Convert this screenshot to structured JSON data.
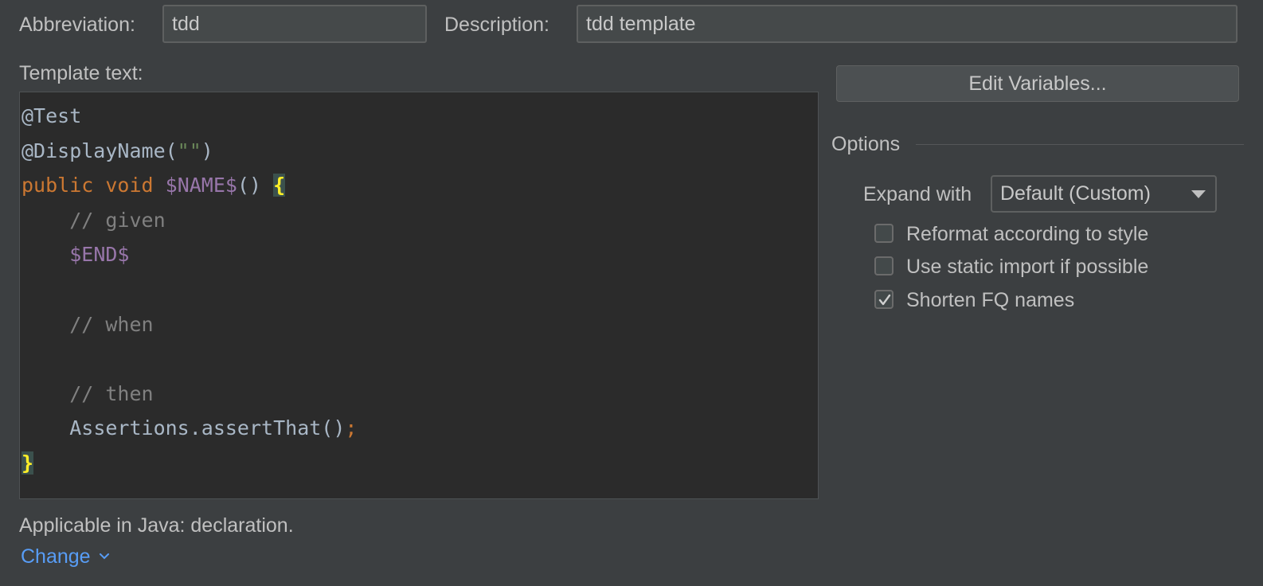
{
  "abbreviation": {
    "label": "Abbreviation:",
    "value": "tdd"
  },
  "description": {
    "label": "Description:",
    "value": "tdd template"
  },
  "template_text_label": "Template text:",
  "code": {
    "line1": "@Test",
    "line2_prefix": "@DisplayName(",
    "line2_string": "\"\"",
    "line2_suffix": ")",
    "line3_kw1": "public",
    "line3_kw2": "void",
    "line3_var": "$NAME$",
    "line3_parens": "()",
    "open_brace": "{",
    "comment_given": "// given",
    "end_var": "$END$",
    "comment_when": "// when",
    "comment_then": "// then",
    "assert_call": "Assertions.assertThat()",
    "semicolon": ";",
    "close_brace": "}"
  },
  "edit_variables_button": "Edit Variables...",
  "options": {
    "title": "Options",
    "expand_with_label": "Expand with",
    "expand_with_value": "Default (Custom)",
    "checkboxes": [
      {
        "label": "Reformat according to style",
        "checked": false
      },
      {
        "label": "Use static import if possible",
        "checked": false
      },
      {
        "label": "Shorten FQ names",
        "checked": true
      }
    ]
  },
  "applicable_text": "Applicable in Java: declaration.",
  "change_link": "Change",
  "icons": {
    "dropdown": "chevron-down-icon",
    "check": "check-icon"
  },
  "colors": {
    "link": "#589df6",
    "keyword": "#cc7832",
    "variable": "#9876aa",
    "comment": "#808080"
  }
}
